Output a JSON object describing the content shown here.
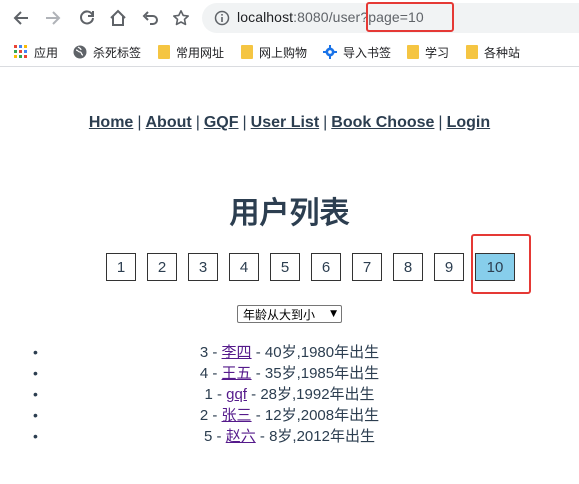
{
  "browser": {
    "url_host": "localhost",
    "url_rest": ":8080/user?page=10",
    "bookmarks": [
      {
        "label": "应用",
        "icon": "apps-grid-icon"
      },
      {
        "label": "杀死标签",
        "icon": "globe-icon"
      },
      {
        "label": "常用网址",
        "icon": "folder-icon"
      },
      {
        "label": "网上购物",
        "icon": "folder-icon"
      },
      {
        "label": "导入书签",
        "icon": "gear-icon"
      },
      {
        "label": "学习",
        "icon": "folder-icon"
      },
      {
        "label": "各种站",
        "icon": "folder-icon"
      }
    ]
  },
  "nav": {
    "links": [
      "Home",
      "About",
      "GQF",
      "User List",
      "Book Choose",
      "Login"
    ],
    "separator": "|"
  },
  "page_title": "用户列表",
  "pagination": {
    "pages": [
      "1",
      "2",
      "3",
      "4",
      "5",
      "6",
      "7",
      "8",
      "9",
      "10"
    ],
    "active": "10"
  },
  "sort": {
    "selected": "年龄从大到小",
    "arrow": "▼"
  },
  "users": [
    {
      "prefix": "3 - ",
      "name": "李四",
      "suffix": " - 40岁,1980年出生"
    },
    {
      "prefix": "4 - ",
      "name": "王五",
      "suffix": " - 35岁,1985年出生"
    },
    {
      "prefix": "1 - ",
      "name": "gqf",
      "suffix": " - 28岁,1992年出生"
    },
    {
      "prefix": "2 - ",
      "name": "张三",
      "suffix": " - 12岁,2008年出生"
    },
    {
      "prefix": "5 - ",
      "name": "赵六",
      "suffix": " - 8岁,2012年出生"
    }
  ],
  "bullet": "•",
  "colors": {
    "highlight_red": "#e53935",
    "active_page": "#87ceeb",
    "text": "#2c3e50",
    "visited_link": "#551a8b"
  }
}
